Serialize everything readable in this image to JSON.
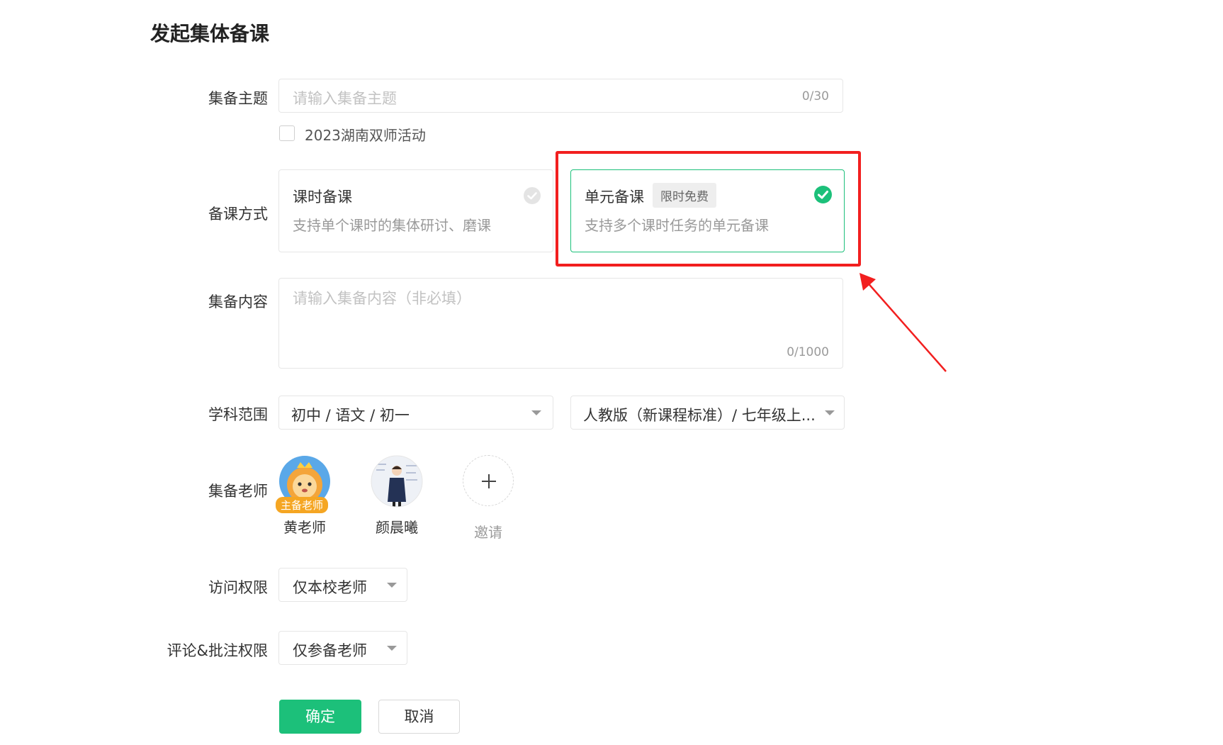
{
  "page": {
    "title": "发起集体备课"
  },
  "topic": {
    "label": "集备主题",
    "placeholder": "请输入集备主题",
    "counter": "0/30"
  },
  "activity_checkbox": {
    "label": "2023湖南双师活动",
    "checked": false
  },
  "method": {
    "label": "备课方式",
    "options": [
      {
        "title": "课时备课",
        "description": "支持单个课时的集体研讨、磨课",
        "tag": "",
        "selected": false
      },
      {
        "title": "单元备课",
        "description": "支持多个课时任务的单元备课",
        "tag": "限时免费",
        "selected": true
      }
    ]
  },
  "content": {
    "label": "集备内容",
    "placeholder": "请输入集备内容（非必填）",
    "counter": "0/1000"
  },
  "subject": {
    "label": "学科范围",
    "select1": "初中 / 语文 / 初一",
    "select2": "人教版（新课程标准）/ 七年级上..."
  },
  "teachers": {
    "label": "集备老师",
    "members": [
      {
        "name": "黄老师",
        "badge": "主备老师"
      },
      {
        "name": "颜晨曦",
        "badge": ""
      }
    ],
    "invite_label": "邀请"
  },
  "access": {
    "label": "访问权限",
    "value": "仅本校老师"
  },
  "comment_permission": {
    "label": "评论&批注权限",
    "value": "仅参备老师"
  },
  "buttons": {
    "confirm": "确定",
    "cancel": "取消"
  },
  "colors": {
    "accent": "#1cc07a",
    "annotation": "#f21f1f"
  }
}
